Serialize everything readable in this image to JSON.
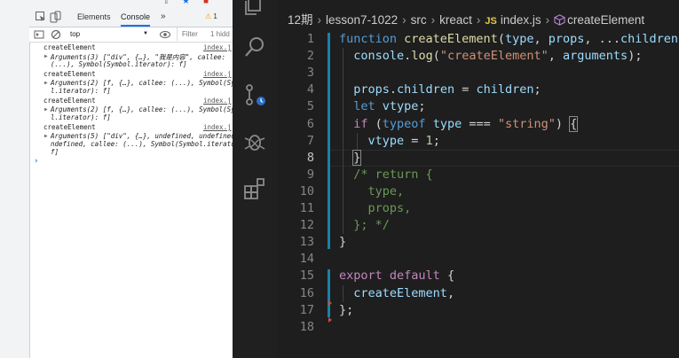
{
  "devtools": {
    "tabs": [
      "Elements",
      "Console"
    ],
    "active_tab": "Console",
    "more_tabs": "»",
    "warning_count": "1",
    "context": "top",
    "filter_placeholder": "Filter",
    "hidden_label": "1 hidd",
    "entries": [
      {
        "name": "createElement",
        "link": "index.j",
        "lines": [
          {
            "prefix": "Arguments(3) ",
            "text": "[\"div\", {…}, \"我是内容\", callee:"
          },
          {
            "prefix": "",
            "text": "(...), Symbol(Symbol.iterator): f]"
          }
        ]
      },
      {
        "name": "createElement",
        "link": "index.j",
        "lines": [
          {
            "prefix": "Arguments(2) ",
            "text": "[f, {…}, callee: (...), Symbol(Sy"
          },
          {
            "prefix": "",
            "text": "l.iterator): f]"
          }
        ]
      },
      {
        "name": "createElement",
        "link": "index.j",
        "lines": [
          {
            "prefix": "Arguments(2) ",
            "text": "[f, {…}, callee: (...), Symbol(Sy"
          },
          {
            "prefix": "",
            "text": "l.iterator): f]"
          }
        ]
      },
      {
        "name": "createElement",
        "link": "index.j",
        "lines": [
          {
            "prefix": "Arguments(5) ",
            "text": "[\"div\", {…}, undefined, undefined"
          },
          {
            "prefix": "",
            "text": "ndefined, callee: (...), Symbol(Symbol.iterator):"
          },
          {
            "prefix": "",
            "text": "f]"
          }
        ]
      }
    ],
    "prompt": "›"
  },
  "vscode": {
    "breadcrumbs": [
      "12期",
      "lesson7-1022",
      "src",
      "kreact",
      "index.js",
      "createElement"
    ],
    "file_badge": "JS",
    "symbol_icon": "cube-icon",
    "current_line": 8,
    "lines": [
      {
        "n": 1,
        "tokens": [
          [
            "kw",
            "function "
          ],
          [
            "fn",
            "createElement"
          ],
          [
            "punc",
            "("
          ],
          [
            "var",
            "type"
          ],
          [
            "punc",
            ", "
          ],
          [
            "var",
            "props"
          ],
          [
            "punc",
            ", ..."
          ],
          [
            "var",
            "children"
          ],
          [
            "punc",
            ") {"
          ]
        ]
      },
      {
        "n": 2,
        "tokens": [
          [
            "punc",
            "  "
          ],
          [
            "var",
            "console"
          ],
          [
            "punc",
            "."
          ],
          [
            "fn",
            "log"
          ],
          [
            "punc",
            "("
          ],
          [
            "strg",
            "\"createElement\""
          ],
          [
            "punc",
            ", "
          ],
          [
            "var",
            "arguments"
          ],
          [
            "punc",
            ");"
          ]
        ]
      },
      {
        "n": 3,
        "tokens": []
      },
      {
        "n": 4,
        "tokens": [
          [
            "punc",
            "  "
          ],
          [
            "var",
            "props"
          ],
          [
            "punc",
            "."
          ],
          [
            "var",
            "children"
          ],
          [
            "punc",
            " = "
          ],
          [
            "var",
            "children"
          ],
          [
            "punc",
            ";"
          ]
        ]
      },
      {
        "n": 5,
        "tokens": [
          [
            "punc",
            "  "
          ],
          [
            "kw",
            "let "
          ],
          [
            "var",
            "vtype"
          ],
          [
            "punc",
            ";"
          ]
        ]
      },
      {
        "n": 6,
        "tokens": [
          [
            "punc",
            "  "
          ],
          [
            "ctrl",
            "if "
          ],
          [
            "punc",
            "("
          ],
          [
            "kw",
            "typeof "
          ],
          [
            "var",
            "type"
          ],
          [
            "punc",
            " === "
          ],
          [
            "strg",
            "\"string\""
          ],
          [
            "punc",
            ") "
          ],
          [
            "punc",
            "{"
          ]
        ]
      },
      {
        "n": 7,
        "tokens": [
          [
            "punc",
            "    "
          ],
          [
            "var",
            "vtype"
          ],
          [
            "punc",
            " = "
          ],
          [
            "num",
            "1"
          ],
          [
            "punc",
            ";"
          ]
        ]
      },
      {
        "n": 8,
        "tokens": [
          [
            "punc",
            "  "
          ],
          [
            "punc",
            "}"
          ]
        ]
      },
      {
        "n": 9,
        "tokens": [
          [
            "cmt",
            "  /* return {"
          ]
        ]
      },
      {
        "n": 10,
        "tokens": [
          [
            "cmt",
            "    type,"
          ]
        ]
      },
      {
        "n": 11,
        "tokens": [
          [
            "cmt",
            "    props,"
          ]
        ]
      },
      {
        "n": 12,
        "tokens": [
          [
            "cmt",
            "  }; */"
          ]
        ]
      },
      {
        "n": 13,
        "tokens": [
          [
            "punc",
            "}"
          ]
        ]
      },
      {
        "n": 14,
        "tokens": []
      },
      {
        "n": 15,
        "tokens": [
          [
            "ctrl",
            "export "
          ],
          [
            "ctrl",
            "default "
          ],
          [
            "punc",
            "{"
          ]
        ]
      },
      {
        "n": 16,
        "tokens": [
          [
            "punc",
            "  "
          ],
          [
            "var",
            "createElement"
          ],
          [
            "punc",
            ","
          ]
        ]
      },
      {
        "n": 17,
        "tokens": [
          [
            "punc",
            "};"
          ]
        ]
      },
      {
        "n": 18,
        "tokens": []
      }
    ]
  },
  "colors": {
    "editor_bg": "#1e1e1e",
    "keyword": "#569cd6",
    "function": "#dcdcaa",
    "variable": "#9cdcfe",
    "string": "#ce9178",
    "comment": "#6a9955",
    "control": "#c586c0",
    "modified_bar": "#1b81a8",
    "devtools_accent": "#1a73e8",
    "console_string": "#c80000"
  },
  "icons": {
    "activity_bar": [
      "explorer-icon",
      "search-icon",
      "source-control-icon",
      "debug-icon",
      "extensions-icon"
    ],
    "devtools": [
      "inspect-element-icon",
      "device-toolbar-icon",
      "sidebar-toggle-icon",
      "clear-console-icon",
      "eye-icon",
      "warning-icon"
    ]
  }
}
